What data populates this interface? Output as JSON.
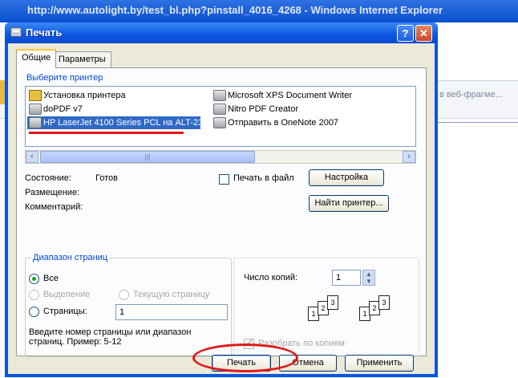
{
  "browser": {
    "title": "http://www.autolight.by/test_bl.php?pinstall_4016_4268 - Windows Internet Explorer",
    "side_fragment": "в веб-фрагме..."
  },
  "dialog": {
    "title": "Печать",
    "help_symbol": "?",
    "close_symbol": "✕",
    "tabs": [
      {
        "label": "Общие"
      },
      {
        "label": "Параметры"
      }
    ],
    "printer_group": {
      "legend": "Выберите принтер",
      "printers": [
        {
          "label": "Установка принтера",
          "icon": "add-printer-icon"
        },
        {
          "label": "doPDF v7",
          "icon": "printer-icon"
        },
        {
          "label": "HP LaserJet 4100 Series PCL на ALT-23",
          "icon": "printer-icon",
          "selected": true
        },
        {
          "label": "Microsoft XPS Document Writer",
          "icon": "printer-icon"
        },
        {
          "label": "Nitro PDF Creator",
          "icon": "printer-icon"
        },
        {
          "label": "Отправить в OneNote 2007",
          "icon": "printer-icon"
        }
      ],
      "status_label": "Состояние:",
      "status_value": "Готов",
      "location_label": "Размещение:",
      "comment_label": "Комментарий:",
      "print_to_file": "Печать в файл",
      "settings_button": "Настройка",
      "find_printer_button": "Найти принтер..."
    },
    "range_group": {
      "legend": "Диапазон страниц",
      "all": "Все",
      "selection": "Выделение",
      "current_page": "Текущую страницу",
      "pages": "Страницы:",
      "pages_value": "1",
      "hint": "Введите номер страницы или диапазон страниц. Пример: 5-12"
    },
    "copies": {
      "label": "Число копий:",
      "value": "1",
      "collate": "Разобрать по копиям",
      "pages": [
        "1",
        "2",
        "3"
      ]
    },
    "buttons": {
      "print": "Печать",
      "cancel": "Отмена",
      "apply": "Применить"
    }
  },
  "colors": {
    "annotation": "#e11818",
    "title_bar": "#0a55e2",
    "selection": "#316ac5"
  }
}
